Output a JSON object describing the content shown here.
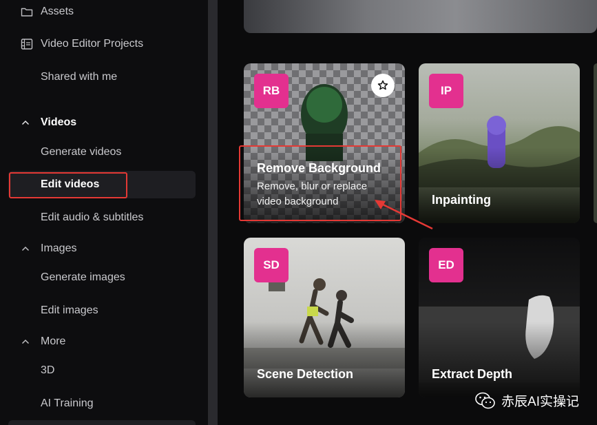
{
  "sidebar": {
    "items": [
      {
        "label": "Assets",
        "icon": "folder-icon"
      },
      {
        "label": "Video Editor Projects",
        "icon": "film-icon"
      },
      {
        "label": "Shared with me"
      }
    ],
    "sections": {
      "videos": {
        "label": "Videos",
        "items": [
          "Generate videos",
          "Edit videos",
          "Edit audio & subtitles"
        ]
      },
      "images": {
        "label": "Images",
        "items": [
          "Generate images",
          "Edit images"
        ]
      },
      "more": {
        "label": "More",
        "items": [
          "3D",
          "AI Training"
        ]
      }
    },
    "active_item": "Edit videos"
  },
  "cards": [
    {
      "badge": "RB",
      "title": "Remove Background",
      "description": "Remove, blur or replace video background",
      "favorite_icon": "star-icon"
    },
    {
      "badge": "IP",
      "title": "Inpainting"
    },
    {
      "badge": "SD",
      "title": "Scene Detection"
    },
    {
      "badge": "ED",
      "title": "Extract Depth"
    }
  ],
  "watermark": {
    "text": "赤辰AI实操记",
    "icon": "wechat-icon"
  },
  "colors": {
    "badge": "#e3308f",
    "highlight": "#e53935",
    "sidebar_bg": "#0d0d0f",
    "active_bg": "#1e1e22"
  }
}
